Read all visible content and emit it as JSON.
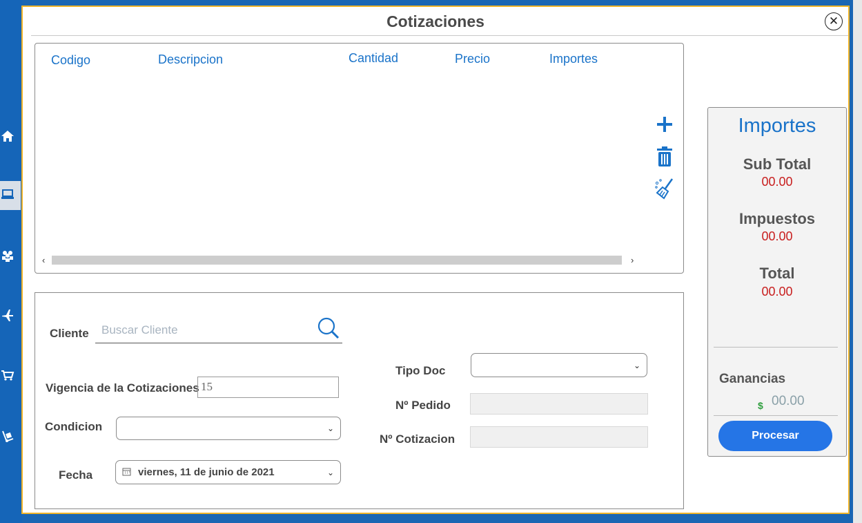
{
  "dialog": {
    "title": "Cotizaciones"
  },
  "grid": {
    "columns": [
      "Codigo",
      "Descripcion",
      "Cantidad",
      "Precio",
      "Importes"
    ]
  },
  "form": {
    "cliente_label": "Cliente",
    "cliente_placeholder": "Buscar Cliente",
    "vigencia_label": "Vigencia de la Cotizaciones",
    "vigencia_value": "15",
    "condicion_label": "Condicion",
    "condicion_value": "",
    "fecha_label": "Fecha",
    "fecha_value": "viernes, 11 de junio de 2021",
    "tipo_doc_label": "Tipo Doc",
    "tipo_doc_value": "",
    "pedido_label": "Nº Pedido",
    "pedido_value": "",
    "cotizacion_label": "Nº Cotizacion",
    "cotizacion_value": ""
  },
  "importes": {
    "title": "Importes",
    "subtotal_label": "Sub Total",
    "subtotal_value": "00.00",
    "impuestos_label": "Impuestos",
    "impuestos_value": "00.00",
    "total_label": "Total",
    "total_value": "00.00",
    "ganancias_label": "Ganancias",
    "ganancias_currency": "$",
    "ganancias_value": "00.00",
    "procesar_label": "Procesar"
  },
  "colors": {
    "accent": "#1a73c9",
    "button": "#2575e6",
    "amount": "#c81e1e",
    "dialog_border": "#f0b429",
    "sidebar": "#1565b8"
  },
  "icons": [
    "home-icon",
    "laptop-icon",
    "users-icon",
    "plane-icon",
    "cart-icon",
    "dolly-icon",
    "close-icon",
    "plus-icon",
    "trash-icon",
    "broom-icon",
    "search-icon",
    "chevron-down-icon",
    "calendar-icon"
  ]
}
